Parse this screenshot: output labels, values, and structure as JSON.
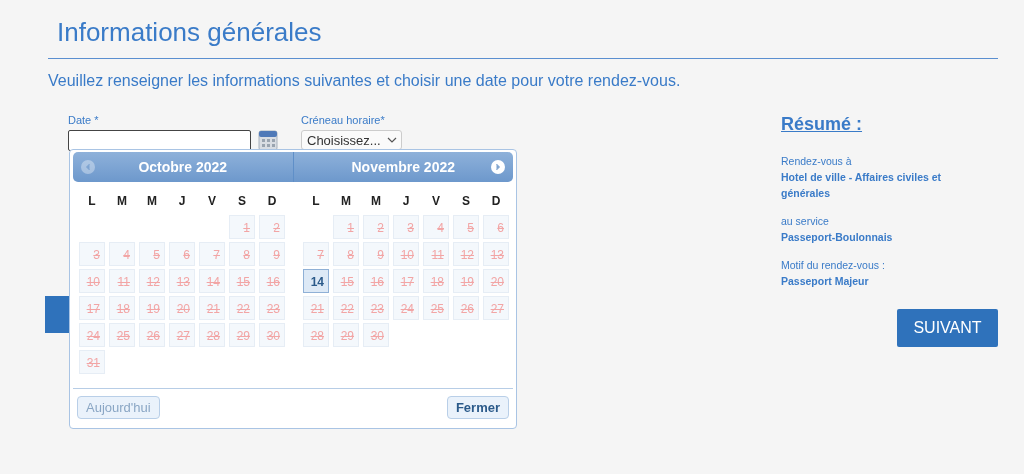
{
  "header": {
    "title": "Informations générales",
    "intro": "Veuillez renseigner les informations suivantes et choisir une date pour votre rendez-vous."
  },
  "form": {
    "date_label": "Date *",
    "slot_label": "Créneau horaire*",
    "slot_value": "Choisissez..."
  },
  "datepicker": {
    "prev": {
      "disabled": true
    },
    "next": {
      "disabled": false
    },
    "months": [
      {
        "title": "Octobre 2022",
        "weekdays": [
          "L",
          "M",
          "M",
          "J",
          "V",
          "S",
          "D"
        ],
        "weeks": [
          [
            {
              "kind": "blank"
            },
            {
              "kind": "blank"
            },
            {
              "kind": "blank"
            },
            {
              "kind": "blank"
            },
            {
              "kind": "blank"
            },
            {
              "kind": "day",
              "label": "1",
              "disabled": true,
              "selected": false
            },
            {
              "kind": "day",
              "label": "2",
              "disabled": true,
              "selected": false
            }
          ],
          [
            {
              "kind": "day",
              "label": "3",
              "disabled": true,
              "selected": false
            },
            {
              "kind": "day",
              "label": "4",
              "disabled": true,
              "selected": false
            },
            {
              "kind": "day",
              "label": "5",
              "disabled": true,
              "selected": false
            },
            {
              "kind": "day",
              "label": "6",
              "disabled": true,
              "selected": false
            },
            {
              "kind": "day",
              "label": "7",
              "disabled": true,
              "selected": false
            },
            {
              "kind": "day",
              "label": "8",
              "disabled": true,
              "selected": false
            },
            {
              "kind": "day",
              "label": "9",
              "disabled": true,
              "selected": false
            }
          ],
          [
            {
              "kind": "day",
              "label": "10",
              "disabled": true,
              "selected": false
            },
            {
              "kind": "day",
              "label": "11",
              "disabled": true,
              "selected": false
            },
            {
              "kind": "day",
              "label": "12",
              "disabled": true,
              "selected": false
            },
            {
              "kind": "day",
              "label": "13",
              "disabled": true,
              "selected": false
            },
            {
              "kind": "day",
              "label": "14",
              "disabled": true,
              "selected": false
            },
            {
              "kind": "day",
              "label": "15",
              "disabled": true,
              "selected": false
            },
            {
              "kind": "day",
              "label": "16",
              "disabled": true,
              "selected": false
            }
          ],
          [
            {
              "kind": "day",
              "label": "17",
              "disabled": true,
              "selected": false
            },
            {
              "kind": "day",
              "label": "18",
              "disabled": true,
              "selected": false
            },
            {
              "kind": "day",
              "label": "19",
              "disabled": true,
              "selected": false
            },
            {
              "kind": "day",
              "label": "20",
              "disabled": true,
              "selected": false
            },
            {
              "kind": "day",
              "label": "21",
              "disabled": true,
              "selected": false
            },
            {
              "kind": "day",
              "label": "22",
              "disabled": true,
              "selected": false
            },
            {
              "kind": "day",
              "label": "23",
              "disabled": true,
              "selected": false
            }
          ],
          [
            {
              "kind": "day",
              "label": "24",
              "disabled": true,
              "selected": false
            },
            {
              "kind": "day",
              "label": "25",
              "disabled": true,
              "selected": false
            },
            {
              "kind": "day",
              "label": "26",
              "disabled": true,
              "selected": false
            },
            {
              "kind": "day",
              "label": "27",
              "disabled": true,
              "selected": false
            },
            {
              "kind": "day",
              "label": "28",
              "disabled": true,
              "selected": false
            },
            {
              "kind": "day",
              "label": "29",
              "disabled": true,
              "selected": false
            },
            {
              "kind": "day",
              "label": "30",
              "disabled": true,
              "selected": false
            }
          ],
          [
            {
              "kind": "day",
              "label": "31",
              "disabled": true,
              "selected": false
            }
          ]
        ]
      },
      {
        "title": "Novembre 2022",
        "weekdays": [
          "L",
          "M",
          "M",
          "J",
          "V",
          "S",
          "D"
        ],
        "weeks": [
          [
            {
              "kind": "blank"
            },
            {
              "kind": "day",
              "label": "1",
              "disabled": true,
              "selected": false
            },
            {
              "kind": "day",
              "label": "2",
              "disabled": true,
              "selected": false
            },
            {
              "kind": "day",
              "label": "3",
              "disabled": true,
              "selected": false
            },
            {
              "kind": "day",
              "label": "4",
              "disabled": true,
              "selected": false
            },
            {
              "kind": "day",
              "label": "5",
              "disabled": true,
              "selected": false
            },
            {
              "kind": "day",
              "label": "6",
              "disabled": true,
              "selected": false
            }
          ],
          [
            {
              "kind": "day",
              "label": "7",
              "disabled": true,
              "selected": false
            },
            {
              "kind": "day",
              "label": "8",
              "disabled": true,
              "selected": false
            },
            {
              "kind": "day",
              "label": "9",
              "disabled": true,
              "selected": false
            },
            {
              "kind": "day",
              "label": "10",
              "disabled": true,
              "selected": false
            },
            {
              "kind": "day",
              "label": "11",
              "disabled": true,
              "selected": false
            },
            {
              "kind": "day",
              "label": "12",
              "disabled": true,
              "selected": false
            },
            {
              "kind": "day",
              "label": "13",
              "disabled": true,
              "selected": false
            }
          ],
          [
            {
              "kind": "day",
              "label": "14",
              "disabled": false,
              "selected": true
            },
            {
              "kind": "day",
              "label": "15",
              "disabled": true,
              "selected": false
            },
            {
              "kind": "day",
              "label": "16",
              "disabled": true,
              "selected": false
            },
            {
              "kind": "day",
              "label": "17",
              "disabled": true,
              "selected": false
            },
            {
              "kind": "day",
              "label": "18",
              "disabled": true,
              "selected": false
            },
            {
              "kind": "day",
              "label": "19",
              "disabled": true,
              "selected": false
            },
            {
              "kind": "day",
              "label": "20",
              "disabled": true,
              "selected": false
            }
          ],
          [
            {
              "kind": "day",
              "label": "21",
              "disabled": true,
              "selected": false
            },
            {
              "kind": "day",
              "label": "22",
              "disabled": true,
              "selected": false
            },
            {
              "kind": "day",
              "label": "23",
              "disabled": true,
              "selected": false
            },
            {
              "kind": "day",
              "label": "24",
              "disabled": true,
              "selected": false
            },
            {
              "kind": "day",
              "label": "25",
              "disabled": true,
              "selected": false
            },
            {
              "kind": "day",
              "label": "26",
              "disabled": true,
              "selected": false
            },
            {
              "kind": "day",
              "label": "27",
              "disabled": true,
              "selected": false
            }
          ],
          [
            {
              "kind": "day",
              "label": "28",
              "disabled": true,
              "selected": false
            },
            {
              "kind": "day",
              "label": "29",
              "disabled": true,
              "selected": false
            },
            {
              "kind": "day",
              "label": "30",
              "disabled": true,
              "selected": false
            }
          ]
        ]
      }
    ],
    "today_button": {
      "label": "Aujourd'hui",
      "disabled": true
    },
    "close_button": {
      "label": "Fermer",
      "disabled": false
    }
  },
  "summary": {
    "title": "Résumé :",
    "items": [
      {
        "label": "Rendez-vous à",
        "value": "Hotel de ville - Affaires civiles et générales"
      },
      {
        "label": "au service",
        "value": "Passeport-Boulonnais"
      },
      {
        "label": "Motif du rendez-vous :",
        "value": "Passeport Majeur"
      }
    ]
  },
  "next_button": "SUIVANT"
}
